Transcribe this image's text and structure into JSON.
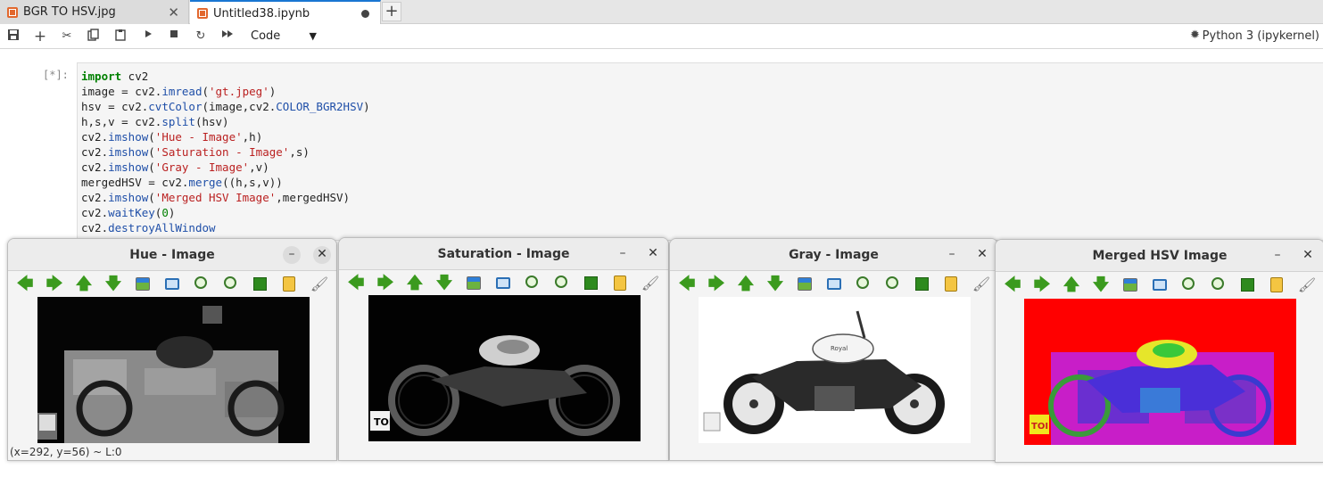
{
  "tabs": [
    {
      "label": "BGR TO HSV.jpg",
      "active": false
    },
    {
      "label": "Untitled38.ipynb",
      "active": true
    }
  ],
  "toolbar": {
    "cell_type": "Code",
    "kernel": "Python 3 (ipykernel)"
  },
  "cell": {
    "prompt": "[*]:",
    "lines": [
      "import cv2",
      "image = cv2.imread('gt.jpeg')",
      "hsv = cv2.cvtColor(image,cv2.COLOR_BGR2HSV)",
      "h,s,v = cv2.split(hsv)",
      "cv2.imshow('Hue - Image',h)",
      "cv2.imshow('Saturation - Image',s)",
      "cv2.imshow('Gray - Image',v)",
      "mergedHSV = cv2.merge((h,s,v))",
      "cv2.imshow('Merged HSV Image',mergedHSV)",
      "cv2.waitKey(0)",
      "cv2.destroyAllWindow"
    ]
  },
  "windows": [
    {
      "title": "Hue - Image",
      "status": "(x=292, y=56) ~ L:0"
    },
    {
      "title": "Saturation - Image"
    },
    {
      "title": "Gray - Image"
    },
    {
      "title": "Merged HSV Image"
    }
  ],
  "logo_text": "TOI",
  "colors": {
    "accent": "#1976d2",
    "tab_icon": "#e2672d",
    "arrow_green": "#3b9a1e",
    "merged_bg": "#ff0000"
  }
}
